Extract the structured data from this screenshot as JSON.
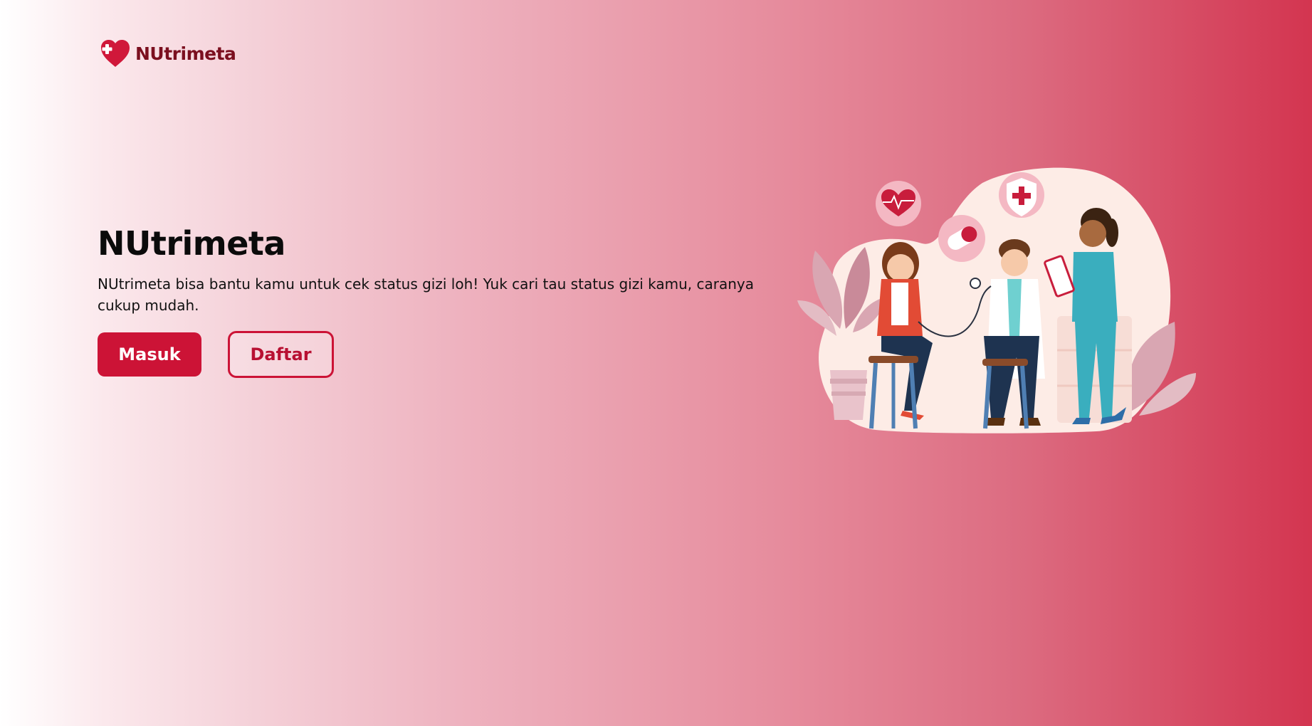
{
  "brand": {
    "name": "NUtrimeta",
    "logo_icon": "heart-plus-icon",
    "color": "#7b0f1f"
  },
  "hero": {
    "title": "NUtrimeta",
    "description": "NUtrimeta bisa bantu kamu untuk cek status gizi loh! Yuk cari tau status gizi kamu, caranya cukup mudah."
  },
  "actions": {
    "login_label": "Masuk",
    "register_label": "Daftar"
  },
  "illustration": {
    "description": "medical-checkup-illustration"
  },
  "colors": {
    "accent": "#cc1336",
    "gradient_start": "#ffffff",
    "gradient_end": "#d33550"
  }
}
